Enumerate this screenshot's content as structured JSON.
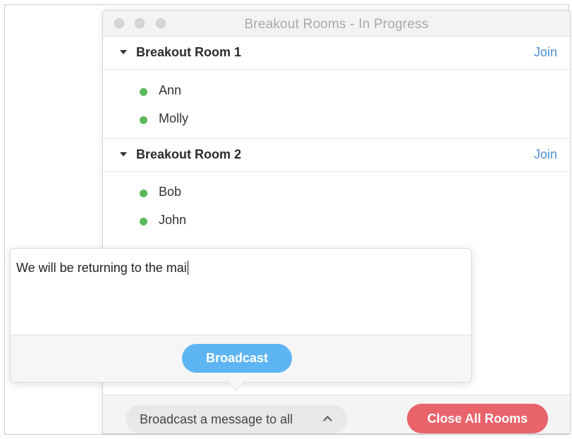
{
  "window": {
    "title": "Breakout Rooms - In Progress"
  },
  "rooms": [
    {
      "name": "Breakout Room 1",
      "join_label": "Join",
      "participants": [
        "Ann",
        "Molly"
      ]
    },
    {
      "name": "Breakout Room 2",
      "join_label": "Join",
      "participants": [
        "Bob",
        "John"
      ]
    }
  ],
  "broadcast_popover": {
    "message_value": "We will be returning to the mai",
    "broadcast_label": "Broadcast"
  },
  "bottom_bar": {
    "broadcast_toggle_label": "Broadcast a message to all",
    "close_all_label": "Close All Rooms"
  },
  "colors": {
    "accent_blue": "#4a90d9",
    "broadcast_button": "#5eb5f4",
    "close_button": "#e9636b",
    "online_dot": "#5cb85c"
  },
  "icons": {
    "traffic_lights": [
      "close-icon",
      "minimize-icon",
      "zoom-icon"
    ],
    "expand": "caret-down-icon",
    "status": "online-dot-icon",
    "toggle": "chevron-up-icon"
  }
}
